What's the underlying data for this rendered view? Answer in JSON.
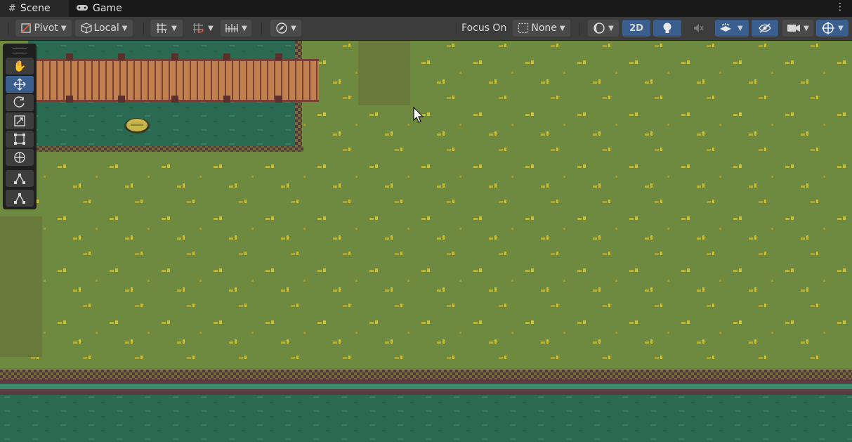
{
  "tabs": [
    {
      "label": "Scene",
      "icon": "hash-icon"
    },
    {
      "label": "Game",
      "icon": "gamepad-icon"
    }
  ],
  "toolbar": {
    "pivot_label": "Pivot",
    "local_label": "Local",
    "focus_label": "Focus On",
    "focus_value": "None",
    "twod_label": "2D"
  },
  "tools": [
    "hand-tool",
    "move-tool",
    "rotate-tool",
    "scale-tool",
    "rect-tool",
    "transform-tool",
    "custom-tool-1",
    "custom-tool-2"
  ],
  "selected_tool": "move-tool",
  "colors": {
    "grass": "#6e8a40",
    "water": "#2b6a52",
    "bridge": "#c0814f",
    "accent_blue": "#3a5f8f"
  }
}
